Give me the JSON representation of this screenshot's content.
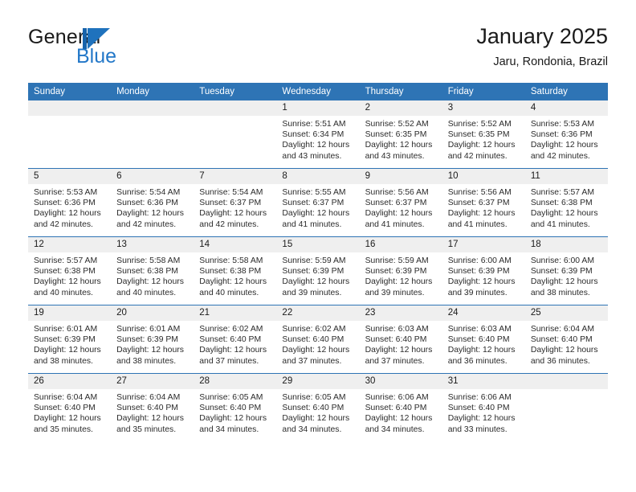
{
  "brand": {
    "word_one": "General",
    "word_two": "Blue",
    "logo_icon": "general-blue-logo",
    "accent_color": "#2277c8"
  },
  "header": {
    "title": "January 2025",
    "subtitle": "Jaru, Rondonia, Brazil"
  },
  "theme": {
    "header_blue": "#2e74b5",
    "daynum_band": "#efefef",
    "text": "#1a1a1a"
  },
  "weekday_headers": [
    "Sunday",
    "Monday",
    "Tuesday",
    "Wednesday",
    "Thursday",
    "Friday",
    "Saturday"
  ],
  "weeks": [
    [
      {
        "day": "",
        "empty": true,
        "sunrise": "",
        "sunset": "",
        "daylight_line1": "",
        "daylight_line2": ""
      },
      {
        "day": "",
        "empty": true,
        "sunrise": "",
        "sunset": "",
        "daylight_line1": "",
        "daylight_line2": ""
      },
      {
        "day": "",
        "empty": true,
        "sunrise": "",
        "sunset": "",
        "daylight_line1": "",
        "daylight_line2": ""
      },
      {
        "day": "1",
        "empty": false,
        "sunrise": "Sunrise: 5:51 AM",
        "sunset": "Sunset: 6:34 PM",
        "daylight_line1": "Daylight: 12 hours",
        "daylight_line2": "and 43 minutes."
      },
      {
        "day": "2",
        "empty": false,
        "sunrise": "Sunrise: 5:52 AM",
        "sunset": "Sunset: 6:35 PM",
        "daylight_line1": "Daylight: 12 hours",
        "daylight_line2": "and 43 minutes."
      },
      {
        "day": "3",
        "empty": false,
        "sunrise": "Sunrise: 5:52 AM",
        "sunset": "Sunset: 6:35 PM",
        "daylight_line1": "Daylight: 12 hours",
        "daylight_line2": "and 42 minutes."
      },
      {
        "day": "4",
        "empty": false,
        "sunrise": "Sunrise: 5:53 AM",
        "sunset": "Sunset: 6:36 PM",
        "daylight_line1": "Daylight: 12 hours",
        "daylight_line2": "and 42 minutes."
      }
    ],
    [
      {
        "day": "5",
        "empty": false,
        "sunrise": "Sunrise: 5:53 AM",
        "sunset": "Sunset: 6:36 PM",
        "daylight_line1": "Daylight: 12 hours",
        "daylight_line2": "and 42 minutes."
      },
      {
        "day": "6",
        "empty": false,
        "sunrise": "Sunrise: 5:54 AM",
        "sunset": "Sunset: 6:36 PM",
        "daylight_line1": "Daylight: 12 hours",
        "daylight_line2": "and 42 minutes."
      },
      {
        "day": "7",
        "empty": false,
        "sunrise": "Sunrise: 5:54 AM",
        "sunset": "Sunset: 6:37 PM",
        "daylight_line1": "Daylight: 12 hours",
        "daylight_line2": "and 42 minutes."
      },
      {
        "day": "8",
        "empty": false,
        "sunrise": "Sunrise: 5:55 AM",
        "sunset": "Sunset: 6:37 PM",
        "daylight_line1": "Daylight: 12 hours",
        "daylight_line2": "and 41 minutes."
      },
      {
        "day": "9",
        "empty": false,
        "sunrise": "Sunrise: 5:56 AM",
        "sunset": "Sunset: 6:37 PM",
        "daylight_line1": "Daylight: 12 hours",
        "daylight_line2": "and 41 minutes."
      },
      {
        "day": "10",
        "empty": false,
        "sunrise": "Sunrise: 5:56 AM",
        "sunset": "Sunset: 6:37 PM",
        "daylight_line1": "Daylight: 12 hours",
        "daylight_line2": "and 41 minutes."
      },
      {
        "day": "11",
        "empty": false,
        "sunrise": "Sunrise: 5:57 AM",
        "sunset": "Sunset: 6:38 PM",
        "daylight_line1": "Daylight: 12 hours",
        "daylight_line2": "and 41 minutes."
      }
    ],
    [
      {
        "day": "12",
        "empty": false,
        "sunrise": "Sunrise: 5:57 AM",
        "sunset": "Sunset: 6:38 PM",
        "daylight_line1": "Daylight: 12 hours",
        "daylight_line2": "and 40 minutes."
      },
      {
        "day": "13",
        "empty": false,
        "sunrise": "Sunrise: 5:58 AM",
        "sunset": "Sunset: 6:38 PM",
        "daylight_line1": "Daylight: 12 hours",
        "daylight_line2": "and 40 minutes."
      },
      {
        "day": "14",
        "empty": false,
        "sunrise": "Sunrise: 5:58 AM",
        "sunset": "Sunset: 6:38 PM",
        "daylight_line1": "Daylight: 12 hours",
        "daylight_line2": "and 40 minutes."
      },
      {
        "day": "15",
        "empty": false,
        "sunrise": "Sunrise: 5:59 AM",
        "sunset": "Sunset: 6:39 PM",
        "daylight_line1": "Daylight: 12 hours",
        "daylight_line2": "and 39 minutes."
      },
      {
        "day": "16",
        "empty": false,
        "sunrise": "Sunrise: 5:59 AM",
        "sunset": "Sunset: 6:39 PM",
        "daylight_line1": "Daylight: 12 hours",
        "daylight_line2": "and 39 minutes."
      },
      {
        "day": "17",
        "empty": false,
        "sunrise": "Sunrise: 6:00 AM",
        "sunset": "Sunset: 6:39 PM",
        "daylight_line1": "Daylight: 12 hours",
        "daylight_line2": "and 39 minutes."
      },
      {
        "day": "18",
        "empty": false,
        "sunrise": "Sunrise: 6:00 AM",
        "sunset": "Sunset: 6:39 PM",
        "daylight_line1": "Daylight: 12 hours",
        "daylight_line2": "and 38 minutes."
      }
    ],
    [
      {
        "day": "19",
        "empty": false,
        "sunrise": "Sunrise: 6:01 AM",
        "sunset": "Sunset: 6:39 PM",
        "daylight_line1": "Daylight: 12 hours",
        "daylight_line2": "and 38 minutes."
      },
      {
        "day": "20",
        "empty": false,
        "sunrise": "Sunrise: 6:01 AM",
        "sunset": "Sunset: 6:39 PM",
        "daylight_line1": "Daylight: 12 hours",
        "daylight_line2": "and 38 minutes."
      },
      {
        "day": "21",
        "empty": false,
        "sunrise": "Sunrise: 6:02 AM",
        "sunset": "Sunset: 6:40 PM",
        "daylight_line1": "Daylight: 12 hours",
        "daylight_line2": "and 37 minutes."
      },
      {
        "day": "22",
        "empty": false,
        "sunrise": "Sunrise: 6:02 AM",
        "sunset": "Sunset: 6:40 PM",
        "daylight_line1": "Daylight: 12 hours",
        "daylight_line2": "and 37 minutes."
      },
      {
        "day": "23",
        "empty": false,
        "sunrise": "Sunrise: 6:03 AM",
        "sunset": "Sunset: 6:40 PM",
        "daylight_line1": "Daylight: 12 hours",
        "daylight_line2": "and 37 minutes."
      },
      {
        "day": "24",
        "empty": false,
        "sunrise": "Sunrise: 6:03 AM",
        "sunset": "Sunset: 6:40 PM",
        "daylight_line1": "Daylight: 12 hours",
        "daylight_line2": "and 36 minutes."
      },
      {
        "day": "25",
        "empty": false,
        "sunrise": "Sunrise: 6:04 AM",
        "sunset": "Sunset: 6:40 PM",
        "daylight_line1": "Daylight: 12 hours",
        "daylight_line2": "and 36 minutes."
      }
    ],
    [
      {
        "day": "26",
        "empty": false,
        "sunrise": "Sunrise: 6:04 AM",
        "sunset": "Sunset: 6:40 PM",
        "daylight_line1": "Daylight: 12 hours",
        "daylight_line2": "and 35 minutes."
      },
      {
        "day": "27",
        "empty": false,
        "sunrise": "Sunrise: 6:04 AM",
        "sunset": "Sunset: 6:40 PM",
        "daylight_line1": "Daylight: 12 hours",
        "daylight_line2": "and 35 minutes."
      },
      {
        "day": "28",
        "empty": false,
        "sunrise": "Sunrise: 6:05 AM",
        "sunset": "Sunset: 6:40 PM",
        "daylight_line1": "Daylight: 12 hours",
        "daylight_line2": "and 34 minutes."
      },
      {
        "day": "29",
        "empty": false,
        "sunrise": "Sunrise: 6:05 AM",
        "sunset": "Sunset: 6:40 PM",
        "daylight_line1": "Daylight: 12 hours",
        "daylight_line2": "and 34 minutes."
      },
      {
        "day": "30",
        "empty": false,
        "sunrise": "Sunrise: 6:06 AM",
        "sunset": "Sunset: 6:40 PM",
        "daylight_line1": "Daylight: 12 hours",
        "daylight_line2": "and 34 minutes."
      },
      {
        "day": "31",
        "empty": false,
        "sunrise": "Sunrise: 6:06 AM",
        "sunset": "Sunset: 6:40 PM",
        "daylight_line1": "Daylight: 12 hours",
        "daylight_line2": "and 33 minutes."
      },
      {
        "day": "",
        "empty": true,
        "sunrise": "",
        "sunset": "",
        "daylight_line1": "",
        "daylight_line2": ""
      }
    ]
  ]
}
